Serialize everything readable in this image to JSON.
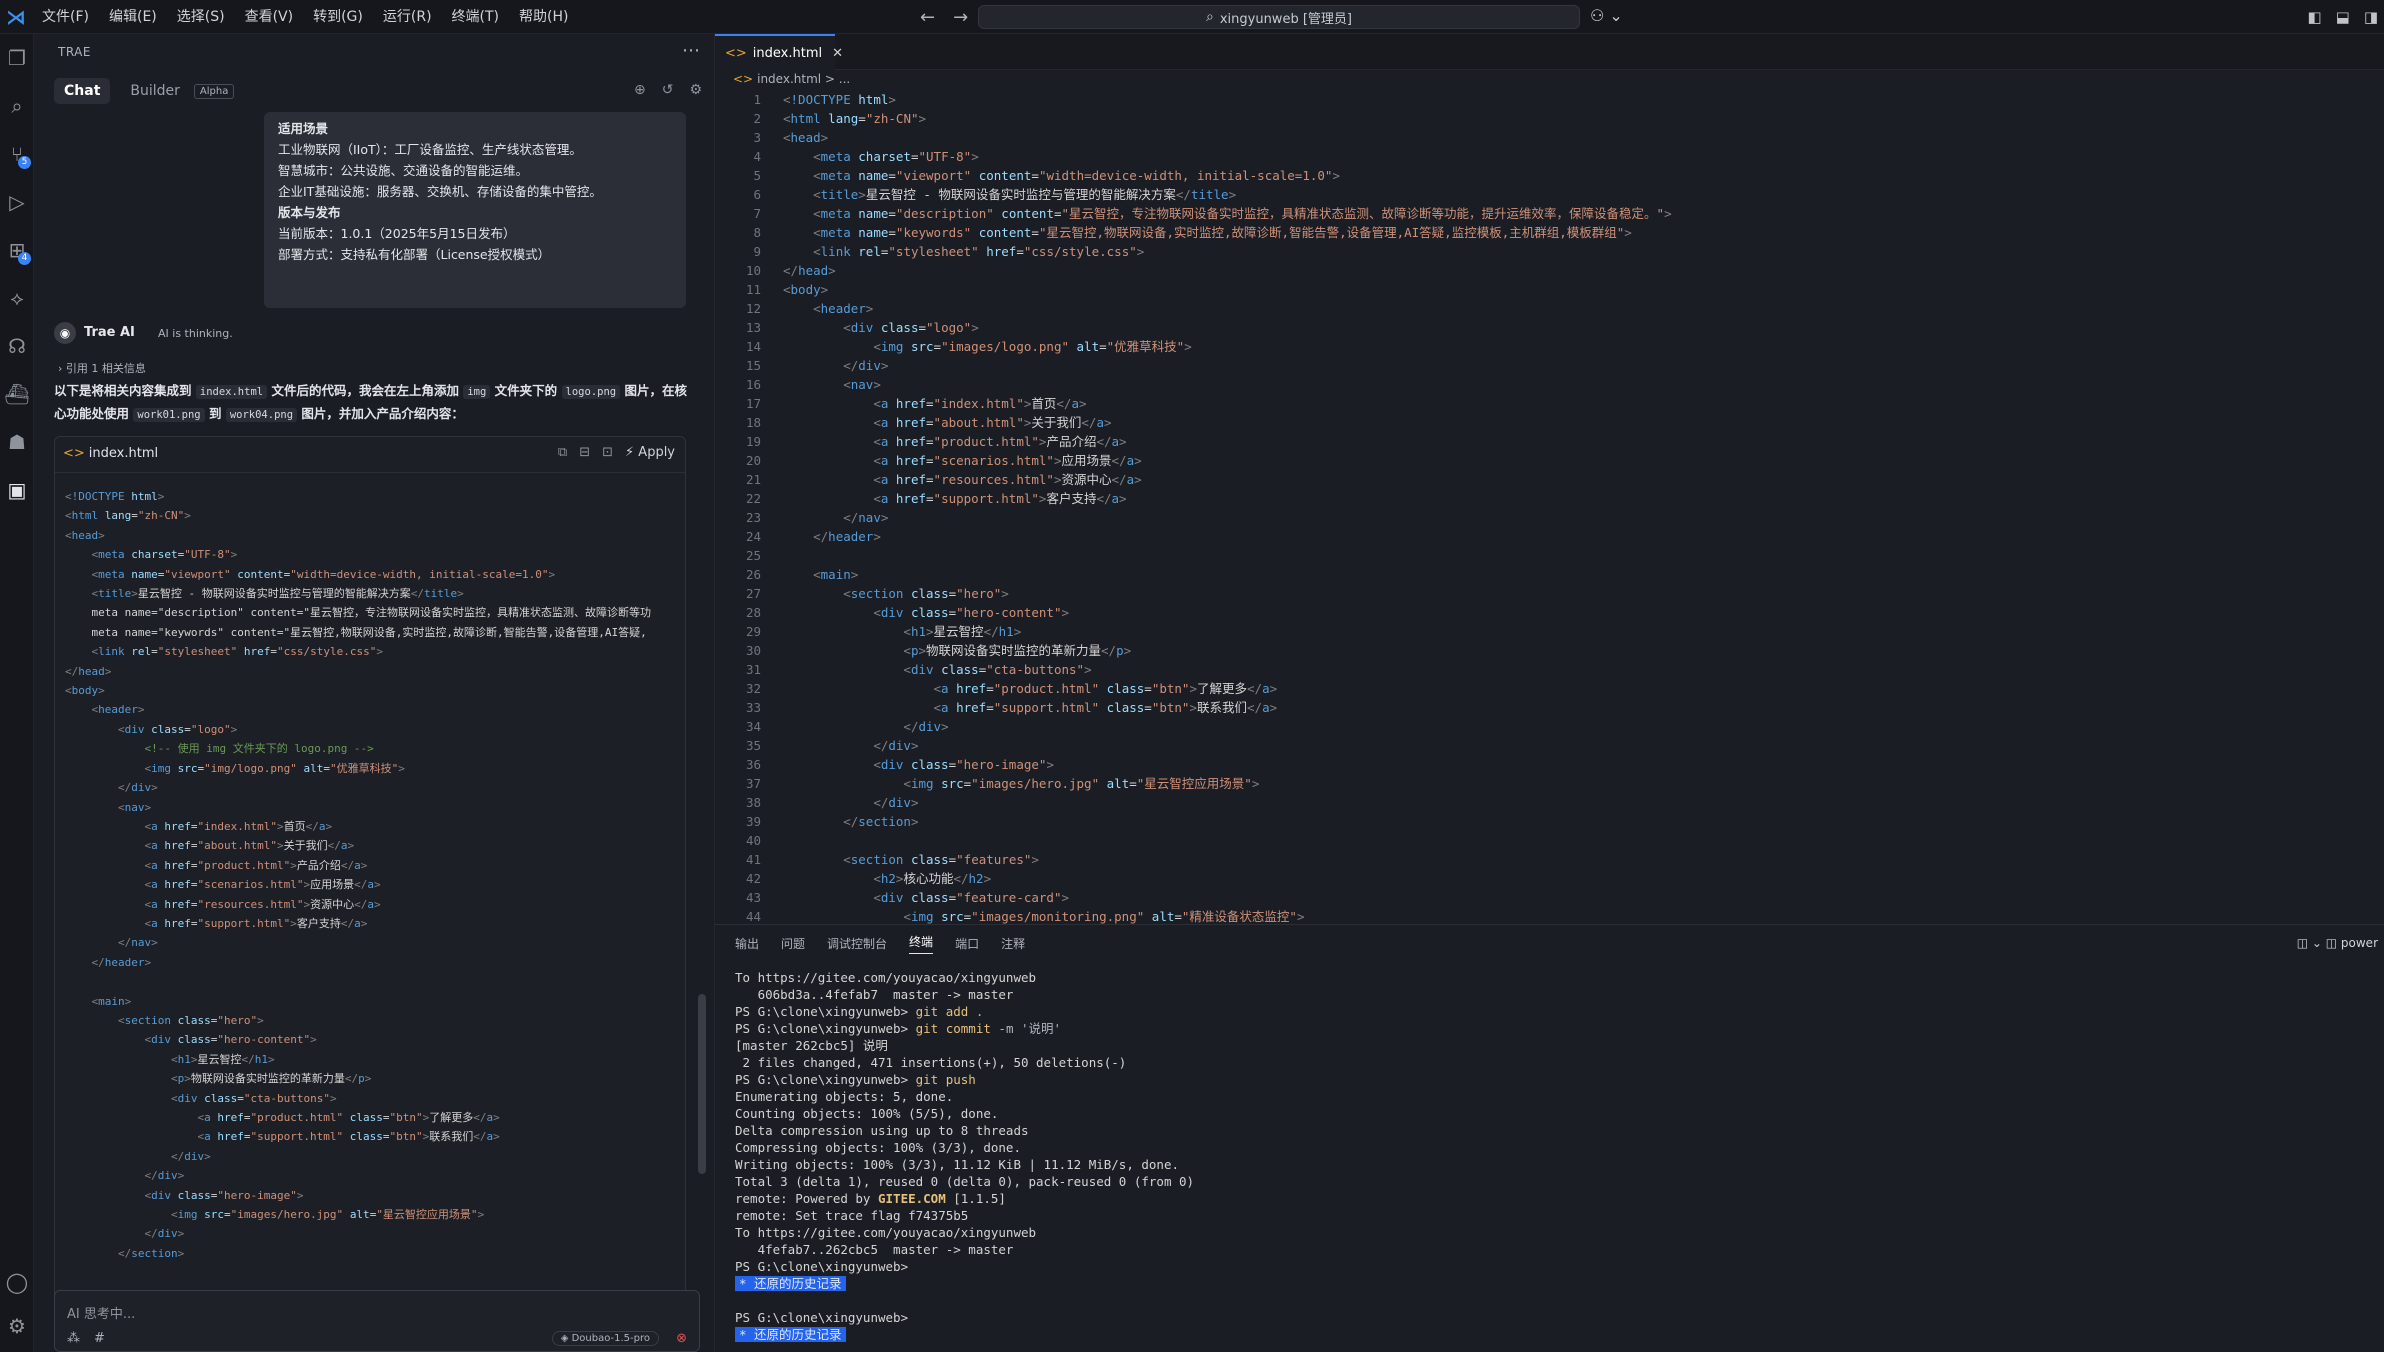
{
  "titlebar": {
    "menus": [
      "文件(F)",
      "编辑(E)",
      "选择(S)",
      "查看(V)",
      "转到(G)",
      "运行(R)",
      "终端(T)",
      "帮助(H)"
    ],
    "search_text": "xingyunweb [管理员]"
  },
  "activity": {
    "badges": {
      "scm": "5",
      "extensions": "4"
    }
  },
  "chat": {
    "panel_title": "TRAE",
    "tabs": {
      "chat": "Chat",
      "builder": "Builder",
      "alpha": "Alpha"
    },
    "user_bubble": [
      {
        "text": "适用场景",
        "bold": true
      },
      {
        "text": "工业物联网（IIoT）：工厂设备监控、生产线状态管理。",
        "bold": false
      },
      {
        "text": "智慧城市：公共设施、交通设备的智能运维。",
        "bold": false
      },
      {
        "text": "企业IT基础设施：服务器、交换机、存储设备的集中管控。",
        "bold": false
      },
      {
        "text": "版本与发布",
        "bold": true
      },
      {
        "text": "当前版本：1.0.1（2025年5月15日发布）",
        "bold": false
      },
      {
        "text": "部署方式：支持私有化部署（License授权模式）",
        "bold": false
      }
    ],
    "ai_name": "Trae AI",
    "ai_status": "AI is thinking.",
    "citation": "引用 1 相关信息",
    "ai_message": {
      "p1": "以下是将相关内容集成到",
      "c1": "index.html",
      "p2": "文件后的代码，我会在左上角添加",
      "c2": "img",
      "p3": "文件夹下的",
      "c3": "logo.png",
      "p4": "图片，在核心功能处使用",
      "c4": "work01.png",
      "p5": "到",
      "c5": "work04.png",
      "p6": "图片，并加入产品介绍内容："
    },
    "code_card": {
      "filename": "index.html",
      "apply_label": "Apply"
    },
    "code_lines": [
      "<!DOCTYPE html>",
      "<html lang=\"zh-CN\">",
      "<head>",
      "    <meta charset=\"UTF-8\">",
      "    <meta name=\"viewport\" content=\"width=device-width, initial-scale=1.0\">",
      "    <title>星云智控 - 物联网设备实时监控与管理的智能解决方案</title>",
      "    <meta name=\"description\" content=\"星云智控，专注物联网设备实时监控，具精准状态监测、故障诊断等功",
      "    <meta name=\"keywords\" content=\"星云智控,物联网设备,实时监控,故障诊断,智能告警,设备管理,AI答疑,",
      "    <link rel=\"stylesheet\" href=\"css/style.css\">",
      "</head>",
      "<body>",
      "    <header>",
      "        <div class=\"logo\">",
      "            <!-- 使用 img 文件夹下的 logo.png -->",
      "            <img src=\"img/logo.png\" alt=\"优雅草科技\">",
      "        </div>",
      "        <nav>",
      "            <a href=\"index.html\">首页</a>",
      "            <a href=\"about.html\">关于我们</a>",
      "            <a href=\"product.html\">产品介绍</a>",
      "            <a href=\"scenarios.html\">应用场景</a>",
      "            <a href=\"resources.html\">资源中心</a>",
      "            <a href=\"support.html\">客户支持</a>",
      "        </nav>",
      "    </header>",
      "",
      "    <main>",
      "        <section class=\"hero\">",
      "            <div class=\"hero-content\">",
      "                <h1>星云智控</h1>",
      "                <p>物联网设备实时监控的革新力量</p>",
      "                <div class=\"cta-buttons\">",
      "                    <a href=\"product.html\" class=\"btn\">了解更多</a>",
      "                    <a href=\"support.html\" class=\"btn\">联系我们</a>",
      "                </div>",
      "            </div>",
      "            <div class=\"hero-image\">",
      "                <img src=\"images/hero.jpg\" alt=\"星云智控应用场景\">",
      "            </div>",
      "        </section>"
    ],
    "input_placeholder": "AI 思考中...",
    "model": "Doubao-1.5-pro"
  },
  "editor": {
    "tab": "index.html",
    "breadcrumb": "index.html > ...",
    "lines": [
      "<!DOCTYPE html>",
      "<html lang=\"zh-CN\">",
      "<head>",
      "    <meta charset=\"UTF-8\">",
      "    <meta name=\"viewport\" content=\"width=device-width, initial-scale=1.0\">",
      "    <title>星云智控 - 物联网设备实时监控与管理的智能解决方案</title>",
      "    <meta name=\"description\" content=\"星云智控，专注物联网设备实时监控，具精准状态监测、故障诊断等功能，提升运维效率，保障设备稳定。\">",
      "    <meta name=\"keywords\" content=\"星云智控,物联网设备,实时监控,故障诊断,智能告警,设备管理,AI答疑,监控模板,主机群组,模板群组\">",
      "    <link rel=\"stylesheet\" href=\"css/style.css\">",
      "</head>",
      "<body>",
      "    <header>",
      "        <div class=\"logo\">",
      "            <img src=\"images/logo.png\" alt=\"优雅草科技\">",
      "        </div>",
      "        <nav>",
      "            <a href=\"index.html\">首页</a>",
      "            <a href=\"about.html\">关于我们</a>",
      "            <a href=\"product.html\">产品介绍</a>",
      "            <a href=\"scenarios.html\">应用场景</a>",
      "            <a href=\"resources.html\">资源中心</a>",
      "            <a href=\"support.html\">客户支持</a>",
      "        </nav>",
      "    </header>",
      "",
      "    <main>",
      "        <section class=\"hero\">",
      "            <div class=\"hero-content\">",
      "                <h1>星云智控</h1>",
      "                <p>物联网设备实时监控的革新力量</p>",
      "                <div class=\"cta-buttons\">",
      "                    <a href=\"product.html\" class=\"btn\">了解更多</a>",
      "                    <a href=\"support.html\" class=\"btn\">联系我们</a>",
      "                </div>",
      "            </div>",
      "            <div class=\"hero-image\">",
      "                <img src=\"images/hero.jpg\" alt=\"星云智控应用场景\">",
      "            </div>",
      "        </section>",
      "",
      "        <section class=\"features\">",
      "            <h2>核心功能</h2>",
      "            <div class=\"feature-card\">",
      "                <img src=\"images/monitoring.png\" alt=\"精准设备状态监控\">"
    ]
  },
  "panel": {
    "tabs": [
      "输出",
      "问题",
      "调试控制台",
      "终端",
      "端口",
      "注释"
    ],
    "active_tab": "终端",
    "right_label": "power",
    "terminal": [
      "To https://gitee.com/youyacao/xingyunweb",
      "   606bd3a..4fefab7  master -> master",
      "PS G:\\clone\\xingyunweb> git add .",
      "PS G:\\clone\\xingyunweb> git commit -m '说明'",
      "[master 262cbc5] 说明",
      " 2 files changed, 471 insertions(+), 50 deletions(-)",
      "PS G:\\clone\\xingyunweb> git push",
      "Enumerating objects: 5, done.",
      "Counting objects: 100% (5/5), done.",
      "Delta compression using up to 8 threads",
      "Compressing objects: 100% (3/3), done.",
      "Writing objects: 100% (3/3), 11.12 KiB | 11.12 MiB/s, done.",
      "Total 3 (delta 1), reused 0 (delta 0), pack-reused 0 (from 0)",
      "remote: Powered by GITEE.COM [1.1.5]",
      "remote: Set trace flag f74375b5",
      "To https://gitee.com/youyacao/xingyunweb",
      "   4fefab7..262cbc5  master -> master",
      "PS G:\\clone\\xingyunweb>",
      "* 还原的历史记录",
      "",
      "PS G:\\clone\\xingyunweb>",
      "* 还原的历史记录"
    ]
  }
}
